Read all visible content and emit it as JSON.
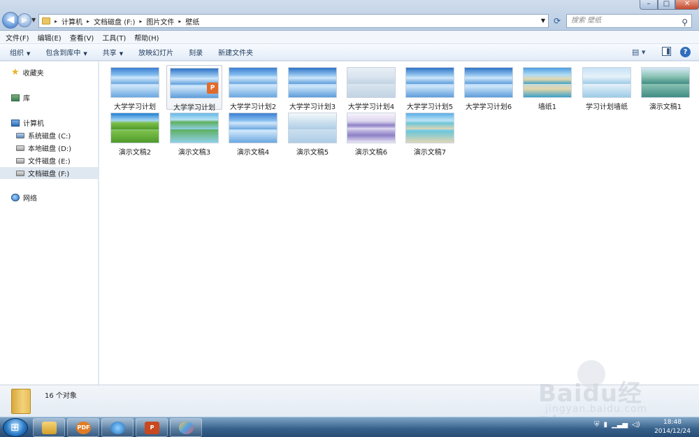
{
  "window": {
    "breadcrumb": [
      "计算机",
      "文档磁盘 (F:)",
      "图片文件",
      "壁纸"
    ],
    "search_placeholder": "搜索 壁纸"
  },
  "menu": [
    "文件(F)",
    "编辑(E)",
    "查看(V)",
    "工具(T)",
    "帮助(H)"
  ],
  "toolbar": {
    "organize": "组织",
    "include_in_library": "包含到库中",
    "share": "共享",
    "slideshow": "放映幻灯片",
    "burn": "刻录",
    "new_folder": "新建文件夹"
  },
  "nav": {
    "favorites": "收藏夹",
    "library": "库",
    "computer": "计算机",
    "drives": [
      "系统磁盘 (C:)",
      "本地磁盘 (D:)",
      "文件磁盘 (E:)",
      "文档磁盘 (F:)"
    ],
    "network": "网络"
  },
  "files": [
    {
      "name": "大学学习计划"
    },
    {
      "name": "大学学习计划"
    },
    {
      "name": "大学学习计划2"
    },
    {
      "name": "大学学习计划3"
    },
    {
      "name": "大学学习计划4"
    },
    {
      "name": "大学学习计划5"
    },
    {
      "name": "大学学习计划6"
    },
    {
      "name": "墙纸1"
    },
    {
      "name": "学习计划墙纸"
    },
    {
      "name": "演示文稿1"
    },
    {
      "name": "演示文稿2"
    },
    {
      "name": "演示文稿3"
    },
    {
      "name": "演示文稿4"
    },
    {
      "name": "演示文稿5"
    },
    {
      "name": "演示文稿6"
    },
    {
      "name": "演示文稿7"
    }
  ],
  "details": {
    "count_text": "16 个对象"
  },
  "taskbar": {
    "ppt_badge": "P",
    "pdf_badge": "PDF",
    "time": "18:48",
    "date": "2014/12/24"
  },
  "watermark": {
    "main": "Baidu经验",
    "sub": "jingyan.baidu.com"
  }
}
